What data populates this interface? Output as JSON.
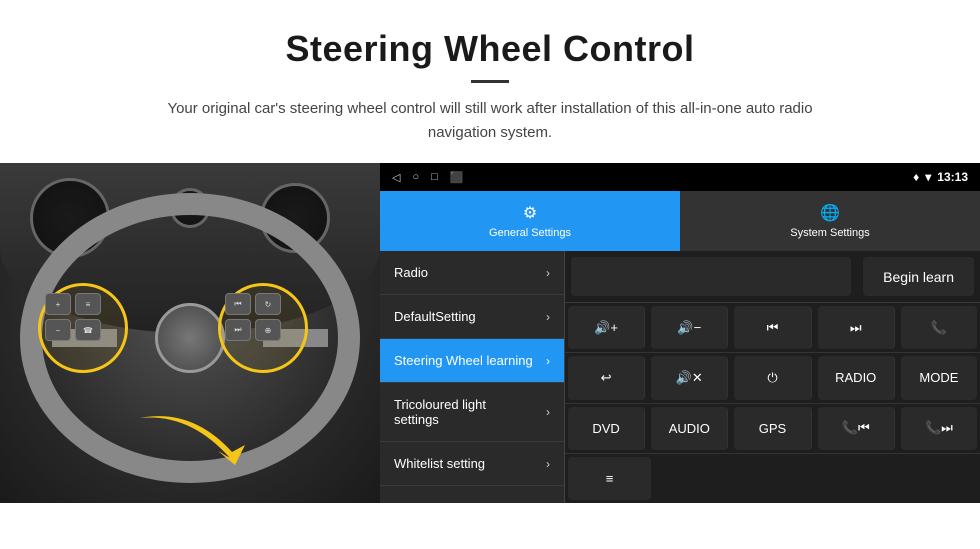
{
  "header": {
    "title": "Steering Wheel Control",
    "description": "Your original car's steering wheel control will still work after installation of this all-in-one auto radio navigation system."
  },
  "status_bar": {
    "nav_icons": [
      "◁",
      "○",
      "□",
      "⬛"
    ],
    "right_icons": "♦ ▾",
    "time": "13:13"
  },
  "tabs": [
    {
      "id": "general",
      "label": "General Settings",
      "icon": "⚙",
      "active": true
    },
    {
      "id": "system",
      "label": "System Settings",
      "icon": "🌐",
      "active": false
    }
  ],
  "menu_items": [
    {
      "label": "Radio",
      "selected": false
    },
    {
      "label": "DefaultSetting",
      "selected": false
    },
    {
      "label": "Steering Wheel learning",
      "selected": true
    },
    {
      "label": "Tricoloured light settings",
      "selected": false
    },
    {
      "label": "Whitelist setting",
      "selected": false
    }
  ],
  "begin_learn_label": "Begin learn",
  "button_rows": [
    [
      {
        "label": "🔊+",
        "type": "icon"
      },
      {
        "label": "🔊−",
        "type": "icon"
      },
      {
        "label": "⏮",
        "type": "icon"
      },
      {
        "label": "⏭",
        "type": "icon"
      },
      {
        "label": "📞",
        "type": "icon"
      }
    ],
    [
      {
        "label": "↩",
        "type": "icon"
      },
      {
        "label": "🔊✕",
        "type": "icon"
      },
      {
        "label": "⏻",
        "type": "icon"
      },
      {
        "label": "RADIO",
        "type": "text"
      },
      {
        "label": "MODE",
        "type": "text"
      }
    ],
    [
      {
        "label": "DVD",
        "type": "text"
      },
      {
        "label": "AUDIO",
        "type": "text"
      },
      {
        "label": "GPS",
        "type": "text"
      },
      {
        "label": "📞⏮",
        "type": "icon"
      },
      {
        "label": "📞⏭",
        "type": "icon"
      }
    ],
    [
      {
        "label": "≡",
        "type": "icon"
      }
    ]
  ]
}
